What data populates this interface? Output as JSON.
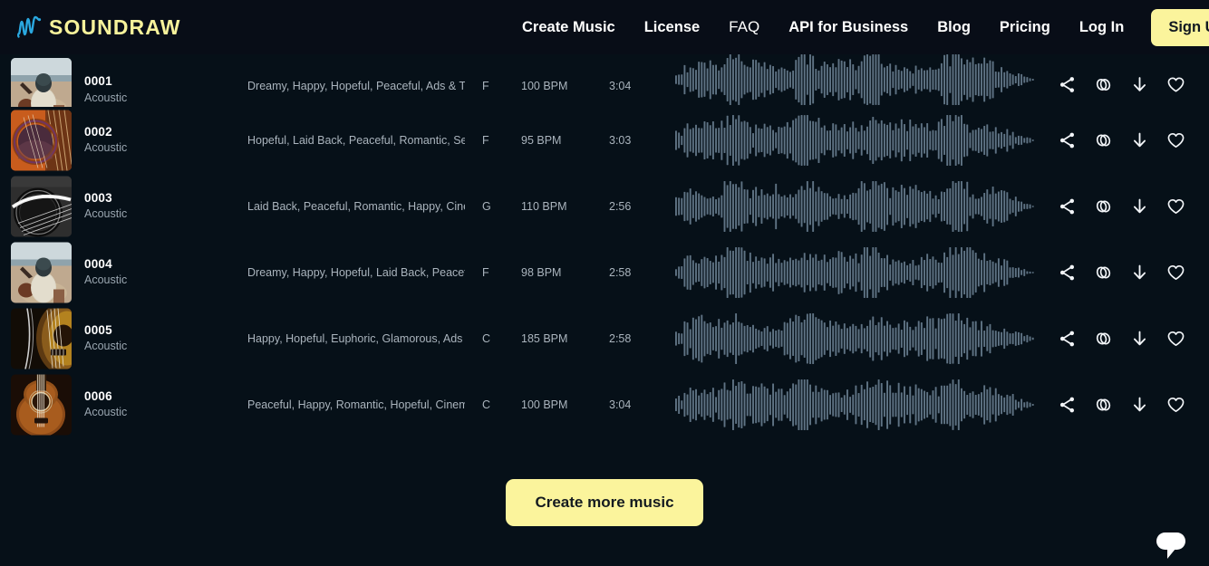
{
  "header": {
    "logo": {
      "text": "SOUNDRAW",
      "mark_color": "#2aa8e0",
      "text_color": "#f7f29b"
    },
    "nav": [
      {
        "label": "Create Music",
        "style": "bold"
      },
      {
        "label": "License",
        "style": "bold"
      },
      {
        "label": "FAQ",
        "style": "light"
      },
      {
        "label": "API for Business",
        "style": "bold"
      },
      {
        "label": "Blog",
        "style": "bold"
      },
      {
        "label": "Pricing",
        "style": "bold"
      },
      {
        "label": "Log In",
        "style": "bold"
      }
    ],
    "signup_label": "Sign Up",
    "signup_bg": "#fbf49c"
  },
  "tracks": [
    {
      "id": "0001",
      "genre": "Acoustic",
      "tags": "Dreamy, Happy, Hopeful, Peaceful, Ads & Trai...",
      "key": "F",
      "bpm": "100 BPM",
      "duration": "3:04",
      "thumb": "beach-guitarist"
    },
    {
      "id": "0002",
      "genre": "Acoustic",
      "tags": "Hopeful, Laid Back, Peaceful, Romantic, Senti...",
      "key": "F",
      "bpm": "95 BPM",
      "duration": "3:03",
      "thumb": "orange-rosette"
    },
    {
      "id": "0003",
      "genre": "Acoustic",
      "tags": "Laid Back, Peaceful, Romantic, Happy, Cinem...",
      "key": "G",
      "bpm": "110 BPM",
      "duration": "2:56",
      "thumb": "bw-strings"
    },
    {
      "id": "0004",
      "genre": "Acoustic",
      "tags": "Dreamy, Happy, Hopeful, Laid Back, Peaceful...",
      "key": "F",
      "bpm": "98 BPM",
      "duration": "2:58",
      "thumb": "beach-guitarist"
    },
    {
      "id": "0005",
      "genre": "Acoustic",
      "tags": "Happy, Hopeful, Euphoric, Glamorous, Ads & ...",
      "key": "C",
      "bpm": "185 BPM",
      "duration": "2:58",
      "thumb": "dark-sunburst"
    },
    {
      "id": "0006",
      "genre": "Acoustic",
      "tags": "Peaceful, Happy, Romantic, Hopeful, Cinemat...",
      "key": "C",
      "bpm": "100 BPM",
      "duration": "3:04",
      "thumb": "warm-acoustic"
    }
  ],
  "row_actions": [
    {
      "name": "share-icon",
      "label": "Share"
    },
    {
      "name": "similar-icon",
      "label": "Find similar"
    },
    {
      "name": "download-icon",
      "label": "Download"
    },
    {
      "name": "favorite-heart-icon",
      "label": "Favorite"
    }
  ],
  "cta": {
    "label": "Create more music",
    "bg": "#fbf49c"
  },
  "chat": {
    "name": "chat-bubble-icon"
  },
  "colors": {
    "page_bg": "#061018",
    "header_bg": "#080d17",
    "accent_yellow": "#fbf49c",
    "muted_text": "#aab4bd",
    "waveform": "#5f7384"
  }
}
